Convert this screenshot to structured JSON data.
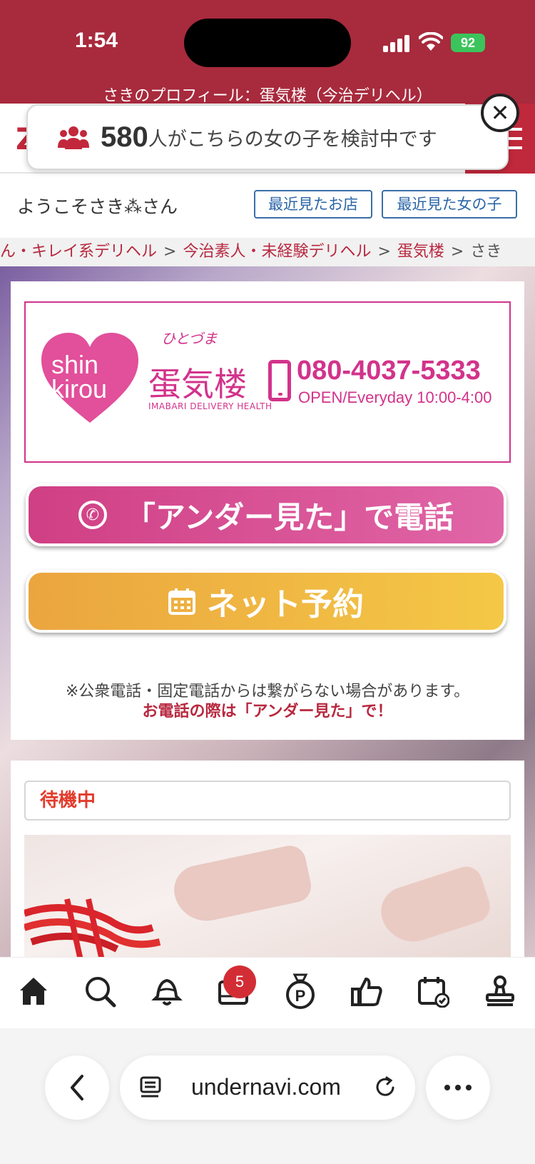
{
  "status_bar": {
    "time": "1:54",
    "battery": "92"
  },
  "page": {
    "title": "さきのプロフィール：蛋気楼（今治デリヘル）"
  },
  "toast": {
    "count": "580",
    "message": "人がこちらの女の子を検討中です",
    "close_label": "✕"
  },
  "welcome": {
    "text": "ようこそさき⁂さん",
    "recent_shops": "最近見たお店",
    "recent_girls": "最近見た女の子"
  },
  "breadcrumb": {
    "items": [
      "ん・キレイ系デリヘル",
      "今治素人・未経験デリヘル",
      "蛋気楼"
    ],
    "current": "さき",
    "separator": ">"
  },
  "shop_banner": {
    "brand_text_line1": "shin",
    "brand_text_line2": "kirou",
    "furigana": "ひとづま",
    "shop_name": "蛋気楼",
    "shop_name_en": "IMABARI DELIVERY HEALTH",
    "phone": "080-4037-5333",
    "hours": "OPEN/Everyday 10:00-4:00"
  },
  "actions": {
    "call_label": "「アンダー見た」で電話",
    "reserve_label": "ネット予約",
    "note": "※公衆電話・固定電話からは繋がらない場合があります。",
    "note_emphasis": "お電話の際は「アンダー見た」で！"
  },
  "status": {
    "label": "待機中"
  },
  "bottom_nav": {
    "badge_count": "5",
    "icons": [
      "home-icon",
      "search-icon",
      "bell-icon",
      "mail-icon",
      "point-bag-icon",
      "thumbs-up-icon",
      "calendar-icon",
      "stamp-icon"
    ]
  },
  "browser": {
    "url": "undernavi.com"
  },
  "colors": {
    "header_red": "#a82a3d",
    "brand_pink": "#d2338b",
    "call_button": "#d03f84",
    "reserve_button": "#f4c846",
    "status_red": "#e23c2d",
    "badge_red": "#d22d34"
  }
}
